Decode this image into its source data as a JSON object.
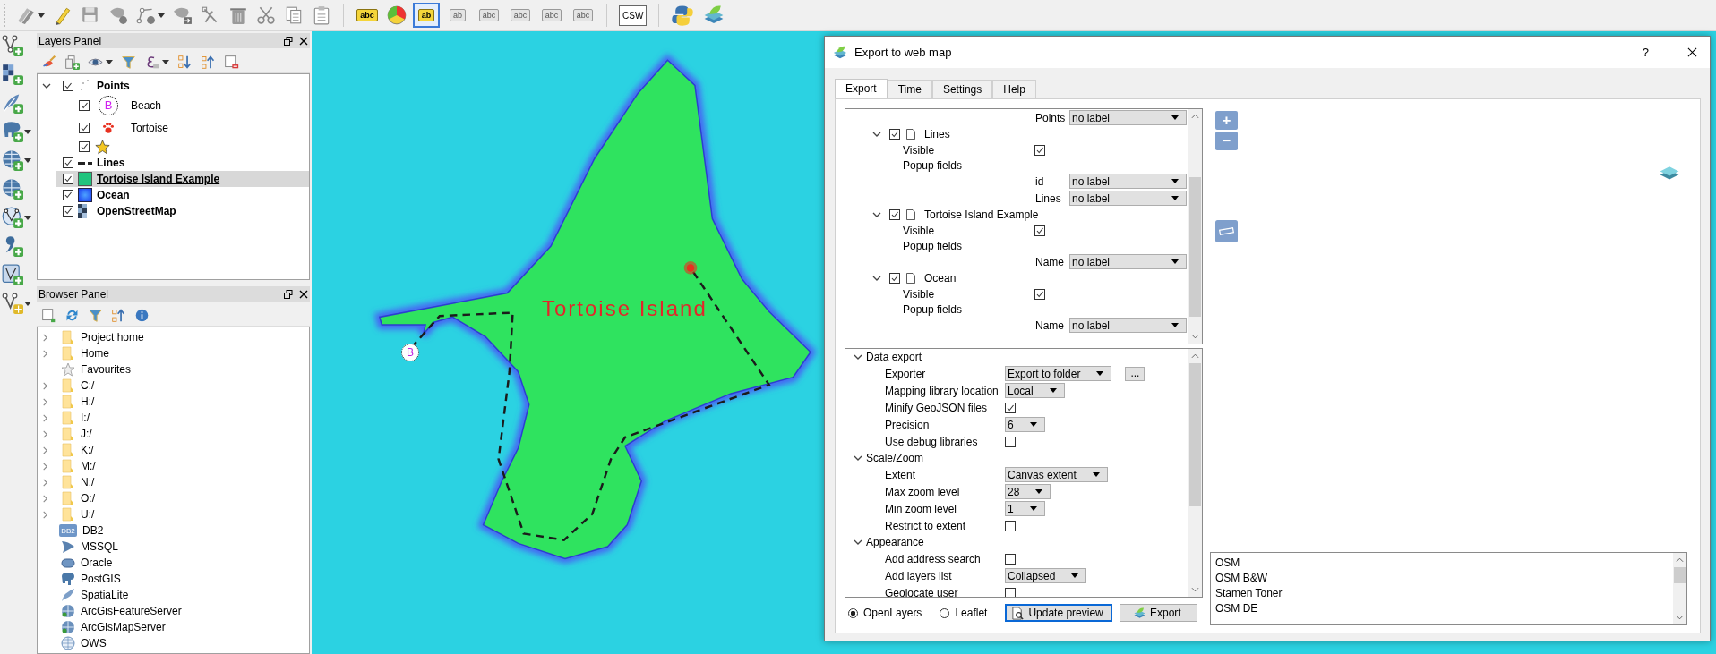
{
  "toolbar": {
    "label_tools": [
      {
        "kind": "tag",
        "text": "abc",
        "selected": false,
        "disabled": false
      },
      {
        "kind": "pie",
        "selected": false,
        "disabled": false
      },
      {
        "kind": "tag",
        "text": "ab",
        "selected": true,
        "disabled": false
      },
      {
        "kind": "tag",
        "text": "ab",
        "selected": false,
        "disabled": true
      },
      {
        "kind": "tag",
        "text": "abc",
        "selected": false,
        "disabled": true
      },
      {
        "kind": "tag",
        "text": "abc",
        "selected": false,
        "disabled": true
      },
      {
        "kind": "tag",
        "text": "abc",
        "selected": false,
        "disabled": true
      },
      {
        "kind": "tag",
        "text": "abc",
        "selected": false,
        "disabled": true
      }
    ],
    "csw_button": "CSW"
  },
  "layers_panel": {
    "title": "Layers Panel",
    "layers": [
      {
        "name": "Points",
        "kind": "points",
        "checked": true,
        "expanded": true,
        "selected": false,
        "children": [
          {
            "name": "Beach",
            "kind": "letter",
            "symbol_text": "B",
            "checked": true,
            "selected": false
          },
          {
            "name": "Tortoise",
            "kind": "paw",
            "checked": true,
            "selected": false
          },
          {
            "kind": "star",
            "checked": true,
            "selected": false
          }
        ]
      },
      {
        "name": "Lines",
        "kind": "dash",
        "checked": true,
        "selected": false
      },
      {
        "name": "Tortoise Island Example",
        "kind": "fill",
        "checked": true,
        "selected": true
      },
      {
        "name": "Ocean",
        "kind": "gradient",
        "checked": true,
        "selected": false
      },
      {
        "name": "OpenStreetMap",
        "kind": "raster",
        "checked": true,
        "selected": false
      }
    ]
  },
  "browser_panel": {
    "title": "Browser Panel",
    "items": [
      {
        "name": "Project home",
        "kind": "folder"
      },
      {
        "name": "Home",
        "kind": "folder"
      },
      {
        "name": "Favourites",
        "kind": "favourites"
      },
      {
        "name": "C:/",
        "kind": "folder"
      },
      {
        "name": "H:/",
        "kind": "folder"
      },
      {
        "name": "I:/",
        "kind": "folder"
      },
      {
        "name": "J:/",
        "kind": "folder"
      },
      {
        "name": "K:/",
        "kind": "folder"
      },
      {
        "name": "M:/",
        "kind": "folder"
      },
      {
        "name": "N:/",
        "kind": "folder"
      },
      {
        "name": "O:/",
        "kind": "folder"
      },
      {
        "name": "U:/",
        "kind": "folder"
      },
      {
        "name": "DB2",
        "kind": "db2",
        "icon_text": "DB2"
      },
      {
        "name": "MSSQL",
        "kind": "mssql"
      },
      {
        "name": "Oracle",
        "kind": "oracle"
      },
      {
        "name": "PostGIS",
        "kind": "postgis"
      },
      {
        "name": "SpatiaLite",
        "kind": "spatialite"
      },
      {
        "name": "ArcGisFeatureServer",
        "kind": "arcgis"
      },
      {
        "name": "ArcGisMapServer",
        "kind": "arcgis"
      },
      {
        "name": "OWS",
        "kind": "ows"
      }
    ]
  },
  "map": {
    "label": "Tortoise Island",
    "marker_text": "B"
  },
  "dialog": {
    "title": "Export to web map",
    "help": "?",
    "tabs": [
      {
        "label": "Export",
        "selected": true
      },
      {
        "label": "Time",
        "selected": false
      },
      {
        "label": "Settings",
        "selected": false
      },
      {
        "label": "Help",
        "selected": false
      }
    ],
    "layer_tree": {
      "top_field": {
        "name": "Points",
        "value": "no label"
      },
      "layers": [
        {
          "name": "Lines",
          "checked": true,
          "expanded": true,
          "visible_label": "Visible",
          "visible": true,
          "popup_label": "Popup fields",
          "fields": [
            {
              "name": "id",
              "value": "no label"
            },
            {
              "name": "Lines",
              "value": "no label"
            }
          ]
        },
        {
          "name": "Tortoise Island Example",
          "checked": true,
          "expanded": true,
          "visible_label": "Visible",
          "visible": true,
          "popup_label": "Popup fields",
          "fields": [
            {
              "name": "Name",
              "value": "no label"
            }
          ]
        },
        {
          "name": "Ocean",
          "checked": true,
          "expanded": true,
          "visible_label": "Visible",
          "visible": true,
          "popup_label": "Popup fields",
          "fields": [
            {
              "name": "Name",
              "value": "no label"
            }
          ]
        }
      ]
    },
    "settings": [
      {
        "title": "Data export",
        "expanded": true,
        "rows": [
          {
            "kind": "select",
            "label": "Exporter",
            "value": "Export to folder",
            "button": "..."
          },
          {
            "kind": "select",
            "label": "Mapping library location",
            "value": "Local"
          },
          {
            "kind": "check",
            "label": "Minify GeoJSON files",
            "checked": true
          },
          {
            "kind": "select",
            "label": "Precision",
            "value": "6"
          },
          {
            "kind": "check",
            "label": "Use debug libraries",
            "checked": false
          }
        ]
      },
      {
        "title": "Scale/Zoom",
        "expanded": true,
        "rows": [
          {
            "kind": "select",
            "label": "Extent",
            "value": "Canvas extent"
          },
          {
            "kind": "select",
            "label": "Max zoom level",
            "value": "28"
          },
          {
            "kind": "select",
            "label": "Min zoom level",
            "value": "1"
          },
          {
            "kind": "check",
            "label": "Restrict to extent",
            "checked": false
          }
        ]
      },
      {
        "title": "Appearance",
        "expanded": true,
        "rows": [
          {
            "kind": "check",
            "label": "Add address search",
            "checked": false
          },
          {
            "kind": "select",
            "label": "Add layers list",
            "value": "Collapsed"
          },
          {
            "kind": "check",
            "label": "Geolocate user",
            "checked": false
          }
        ]
      }
    ],
    "libraries": [
      {
        "label": "OpenLayers",
        "selected": true
      },
      {
        "label": "Leaflet",
        "selected": false
      }
    ],
    "update_button": "Update preview",
    "export_button": "Export",
    "preview": {
      "zoom_in": "+",
      "zoom_out": "−",
      "basemaps": [
        "OSM",
        "OSM B&W",
        "Stamen Toner",
        "OSM DE"
      ]
    }
  }
}
